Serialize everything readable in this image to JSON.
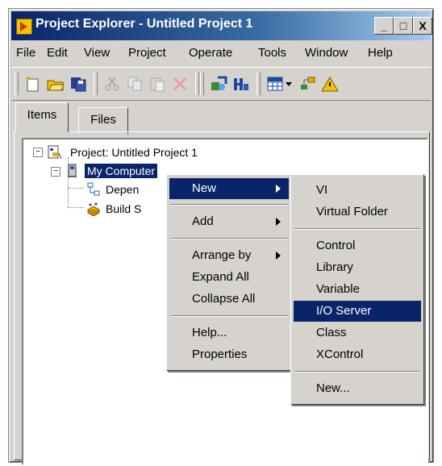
{
  "window": {
    "title": "Project Explorer - Untitled Project 1",
    "controls": {
      "minimize": "_",
      "maximize": "□",
      "close": "X"
    }
  },
  "menubar": [
    "File",
    "Edit",
    "View",
    "Project",
    "Operate",
    "Tools",
    "Window",
    "Help"
  ],
  "toolbar": {
    "icons": [
      "new-icon",
      "open-icon",
      "save-all-icon",
      "cut-icon",
      "copy-icon",
      "paste-icon",
      "delete-icon",
      "build-icon",
      "deploy-icon",
      "grid-icon",
      "dropdown-arrow-icon",
      "hierarchy-icon",
      "warning-icon"
    ]
  },
  "tabs": [
    "Items",
    "Files"
  ],
  "tree": {
    "project": "Project: Untitled Project 1",
    "computer": "My Computer",
    "dependencies": "Depen",
    "build": "Build S"
  },
  "context_menu": {
    "items": [
      {
        "label": "New",
        "submenu": true,
        "highlighted": true
      },
      {
        "label": "Add",
        "submenu": true
      },
      {
        "label": "Arrange by",
        "submenu": true
      },
      {
        "label": "Expand All"
      },
      {
        "label": "Collapse All"
      },
      {
        "label": "Help..."
      },
      {
        "label": "Properties"
      }
    ]
  },
  "new_submenu": {
    "items": [
      {
        "label": "VI"
      },
      {
        "label": "Virtual Folder"
      },
      {
        "label": "Control"
      },
      {
        "label": "Library"
      },
      {
        "label": "Variable"
      },
      {
        "label": "I/O Server",
        "highlighted": true
      },
      {
        "label": "Class"
      },
      {
        "label": "XControl"
      },
      {
        "label": "New..."
      }
    ]
  },
  "colors": {
    "title_gradient_start": "#0a246a",
    "highlight": "#0a246a",
    "face": "#d6d3ce"
  }
}
